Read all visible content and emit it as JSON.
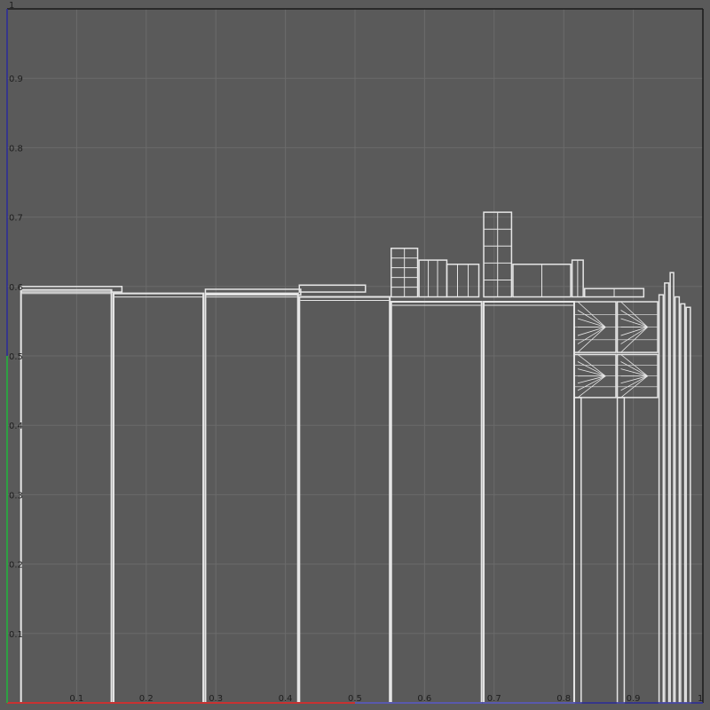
{
  "viewport": {
    "type": "uv-texture-editor",
    "u_range": [
      0,
      1
    ],
    "v_range": [
      0,
      1
    ],
    "grid_step": 0.1,
    "grid": true
  },
  "colors": {
    "background": "#5a5a5a",
    "grid_line": "#6b6b6b",
    "uv_edge": "#e6e6e6",
    "u_axis": "#c83232",
    "v_axis": "#2ea043",
    "boundary": "#2a2a9a",
    "tile_border": "#1a1a1a"
  },
  "axis_labels": {
    "u": [
      "0.1",
      "0.2",
      "0.3",
      "0.4",
      "0.5",
      "0.6",
      "0.7",
      "0.8",
      "0.9"
    ],
    "v": [
      "0.1",
      "0.2",
      "0.3",
      "0.4",
      "0.5",
      "0.6",
      "0.7",
      "0.8",
      "0.9"
    ],
    "corner_top": "1",
    "corner_right": "1"
  },
  "uv_shells": {
    "large_panels": [
      {
        "u": [
          0.02,
          0.15
        ],
        "v": [
          0.0,
          0.595
        ]
      },
      {
        "u": [
          0.153,
          0.282
        ],
        "v": [
          0.0,
          0.59
        ]
      },
      {
        "u": [
          0.285,
          0.418
        ],
        "v": [
          0.0,
          0.59
        ]
      },
      {
        "u": [
          0.42,
          0.55
        ],
        "v": [
          0.0,
          0.585
        ]
      },
      {
        "u": [
          0.552,
          0.682
        ],
        "v": [
          0.0,
          0.578
        ]
      },
      {
        "u": [
          0.685,
          0.815
        ],
        "v": [
          0.0,
          0.578
        ]
      }
    ],
    "top_strips": [
      {
        "u": [
          0.02,
          0.165
        ],
        "v": [
          0.592,
          0.6
        ]
      },
      {
        "u": [
          0.285,
          0.422
        ],
        "v": [
          0.588,
          0.596
        ]
      },
      {
        "u": [
          0.42,
          0.515
        ],
        "v": [
          0.592,
          0.602
        ]
      }
    ],
    "small_blocks": [
      {
        "u": [
          0.552,
          0.59
        ],
        "v": [
          0.585,
          0.655
        ]
      },
      {
        "u": [
          0.592,
          0.632
        ],
        "v": [
          0.585,
          0.638
        ]
      },
      {
        "u": [
          0.632,
          0.678
        ],
        "v": [
          0.585,
          0.632
        ]
      },
      {
        "u": [
          0.685,
          0.725
        ],
        "v": [
          0.585,
          0.707
        ]
      },
      {
        "u": [
          0.727,
          0.81
        ],
        "v": [
          0.585,
          0.632
        ]
      },
      {
        "u": [
          0.812,
          0.828
        ],
        "v": [
          0.585,
          0.638
        ]
      },
      {
        "u": [
          0.83,
          0.915
        ],
        "v": [
          0.585,
          0.597
        ]
      }
    ],
    "right_column_blocks": [
      {
        "u": [
          0.815,
          0.875
        ],
        "v": [
          0.505,
          0.578
        ]
      },
      {
        "u": [
          0.877,
          0.935
        ],
        "v": [
          0.505,
          0.578
        ]
      },
      {
        "u": [
          0.815,
          0.875
        ],
        "v": [
          0.44,
          0.502
        ]
      },
      {
        "u": [
          0.877,
          0.935
        ],
        "v": [
          0.44,
          0.502
        ]
      }
    ],
    "thin_strips": [
      {
        "u": [
          0.815,
          0.825
        ],
        "v": [
          0.0,
          0.44
        ]
      },
      {
        "u": [
          0.877,
          0.887
        ],
        "v": [
          0.0,
          0.44
        ]
      },
      {
        "u": [
          0.937,
          0.943
        ],
        "v": [
          0.0,
          0.588
        ]
      },
      {
        "u": [
          0.945,
          0.951
        ],
        "v": [
          0.0,
          0.605
        ]
      },
      {
        "u": [
          0.953,
          0.958
        ],
        "v": [
          0.0,
          0.62
        ]
      },
      {
        "u": [
          0.96,
          0.966
        ],
        "v": [
          0.0,
          0.585
        ]
      },
      {
        "u": [
          0.968,
          0.974
        ],
        "v": [
          0.0,
          0.575
        ]
      },
      {
        "u": [
          0.976,
          0.982
        ],
        "v": [
          0.0,
          0.57
        ]
      }
    ]
  }
}
